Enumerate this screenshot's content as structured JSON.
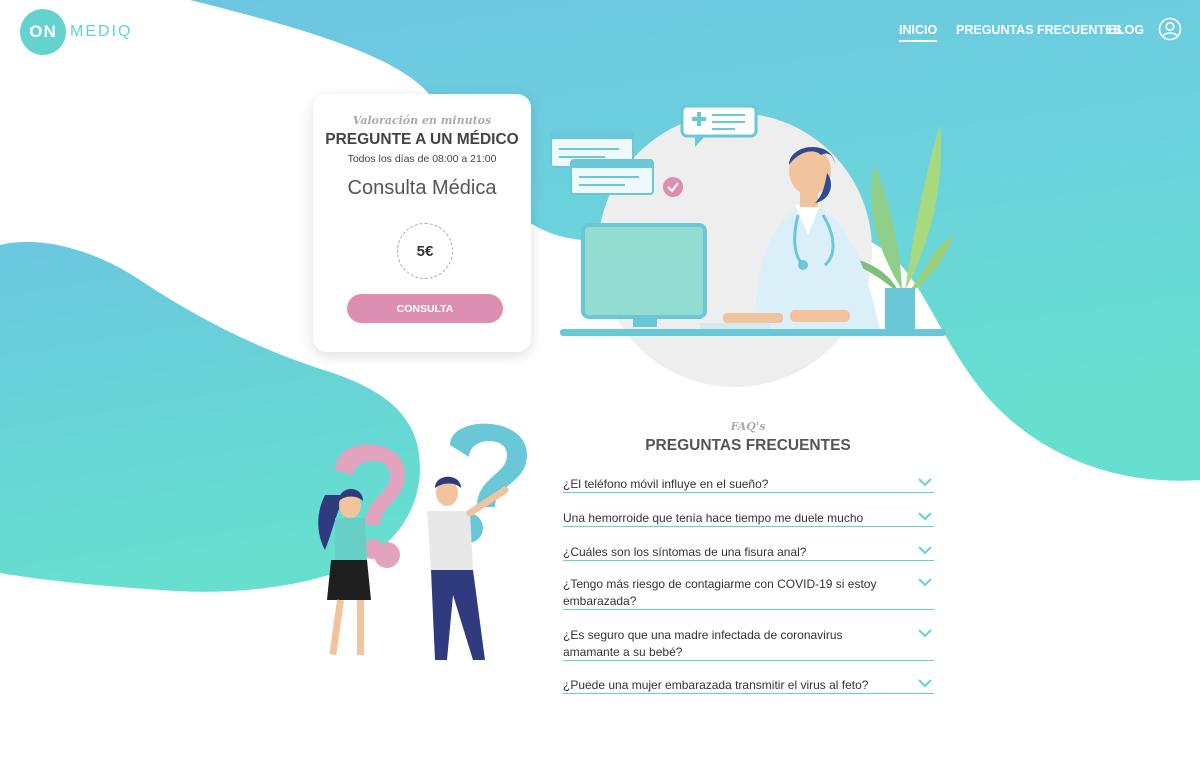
{
  "brand": {
    "logo_on": "ON",
    "logo_text": "MEDIQ",
    "colors": {
      "teal": "#64d3cf",
      "sky": "#68c8e0",
      "pink": "#dc8fb1"
    }
  },
  "nav": {
    "items": [
      {
        "label": "INICIO",
        "active": true
      },
      {
        "label": "PREGUNTAS FRECUENTES",
        "active": false
      },
      {
        "label": "BLOG",
        "active": false
      }
    ],
    "user_icon": "user-circle-icon"
  },
  "consult_card": {
    "subtitle": "Valoración en minutos",
    "title": "PREGUNTE A UN MÉDICO",
    "hours": "Todos los días de 08:00 a 21:00",
    "service": "Consulta Médica",
    "price": "5€",
    "button_label": "CONSULTA"
  },
  "faq": {
    "subtitle": "FAQ's",
    "title": "PREGUNTAS FRECUENTES",
    "items": [
      {
        "question": "¿El teléfono móvil influye en el sueño?"
      },
      {
        "question": "Una hemorroide que tenía hace tiempo me duele mucho"
      },
      {
        "question": "¿Cuáles son los síntomas de una fisura anal?"
      },
      {
        "question": "¿Tengo más riesgo de contagiarme con COVID-19 si estoy embarazada?"
      },
      {
        "question": "¿Es seguro que una madre infectada de coronavirus amamante a su bebé?"
      },
      {
        "question": "¿Puede una mujer embarazada transmitir el virus al feto?"
      }
    ],
    "chevron_icon": "chevron-down-icon"
  },
  "illustrations": {
    "hero": "doctor-at-computer-illustration",
    "faq": "people-with-question-marks-illustration"
  }
}
